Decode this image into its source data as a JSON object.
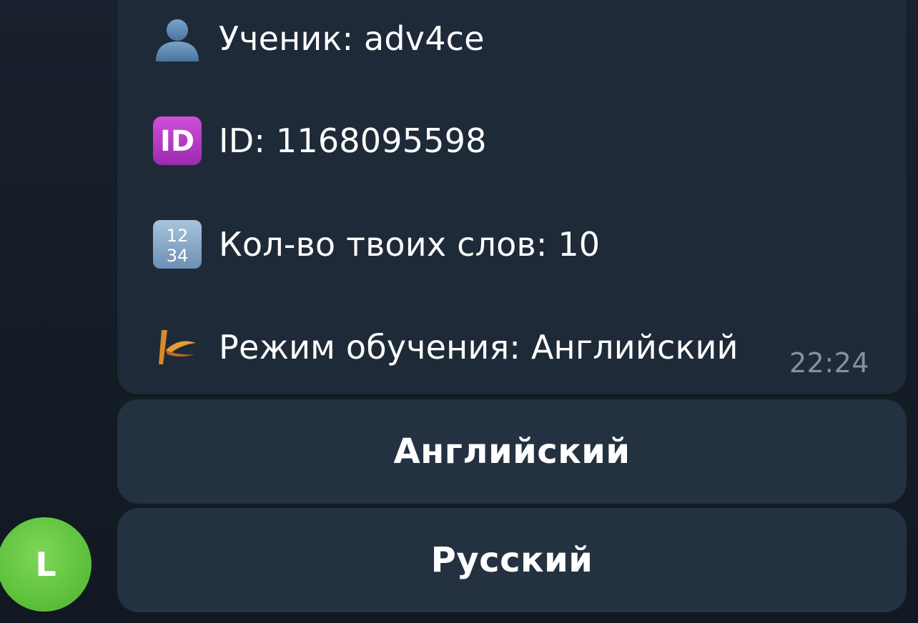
{
  "message": {
    "lines": [
      {
        "icon": "user-silhouette-icon",
        "text": "Ученик: adv4ce"
      },
      {
        "icon": "id-icon",
        "text": "ID: 1168095598"
      },
      {
        "icon": "input-numbers-icon",
        "text": "Кол-во твоих слов: 10"
      },
      {
        "icon": "boomerang-icon",
        "text": "Режим обучения: Английский"
      }
    ],
    "time": "22:24",
    "id_badge_text": "ID",
    "numbers_badge_text": [
      "12",
      "34"
    ]
  },
  "keyboard": {
    "buttons": [
      {
        "label": "Английский"
      },
      {
        "label": "Русский"
      }
    ]
  },
  "avatar": {
    "initial": "L",
    "color": "#5ec23d"
  },
  "colors": {
    "background": "#16202b",
    "bubble": "#1f2a38",
    "button": "#243140",
    "time": "#8392a3"
  }
}
